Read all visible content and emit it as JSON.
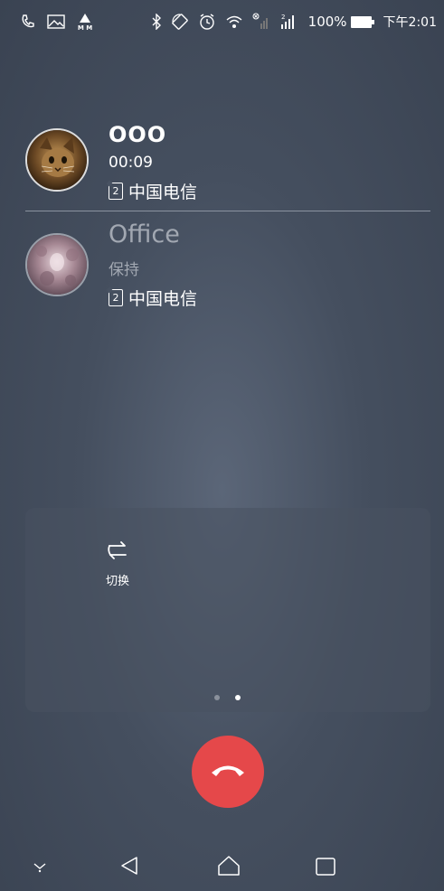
{
  "status_bar": {
    "battery": "100%",
    "time": "下午2:01",
    "signal_digit": "2"
  },
  "calls": [
    {
      "name": "OOO",
      "status": "00:09",
      "carrier": "中国电信",
      "sim": "2"
    },
    {
      "name": "Office",
      "status": "保持",
      "carrier": "中国电信",
      "sim": "2"
    }
  ],
  "panel": {
    "switch_label": "切换"
  },
  "colors": {
    "end_call": "#e5484a",
    "held_text": "#a2a8b2"
  }
}
